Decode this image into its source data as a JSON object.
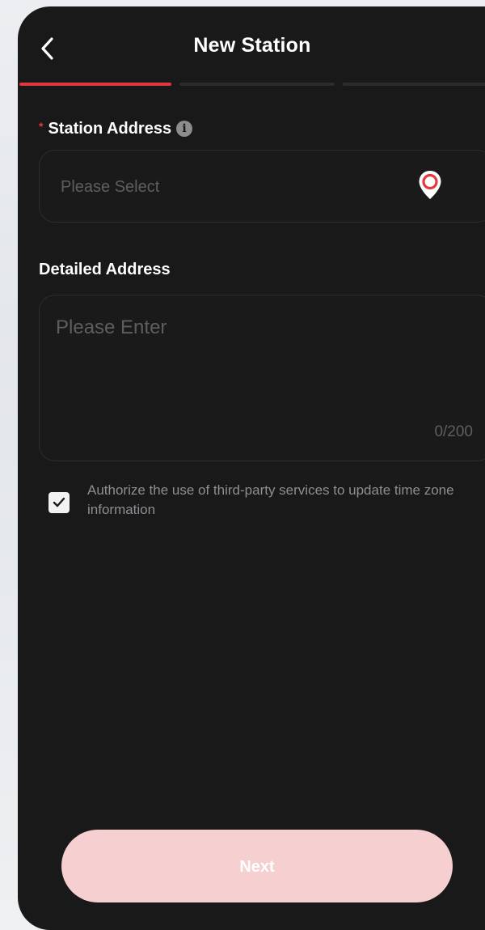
{
  "header": {
    "title": "New Station",
    "back_icon": "chevron-left-icon"
  },
  "progress": {
    "current_step": 1,
    "total_steps": 3,
    "accent_color": "#e2393d"
  },
  "station_address": {
    "label": "Station Address",
    "required_mark": "*",
    "info_icon": "i",
    "placeholder": "Please Select",
    "location_icon": "map-pin-icon"
  },
  "detailed_address": {
    "label": "Detailed Address",
    "placeholder": "Please Enter",
    "counter": "0/200"
  },
  "consent": {
    "checked": true,
    "text": "Authorize the use of third-party services to update time zone information"
  },
  "footer": {
    "next_label": "Next",
    "button_color": "#f6cfd1"
  }
}
